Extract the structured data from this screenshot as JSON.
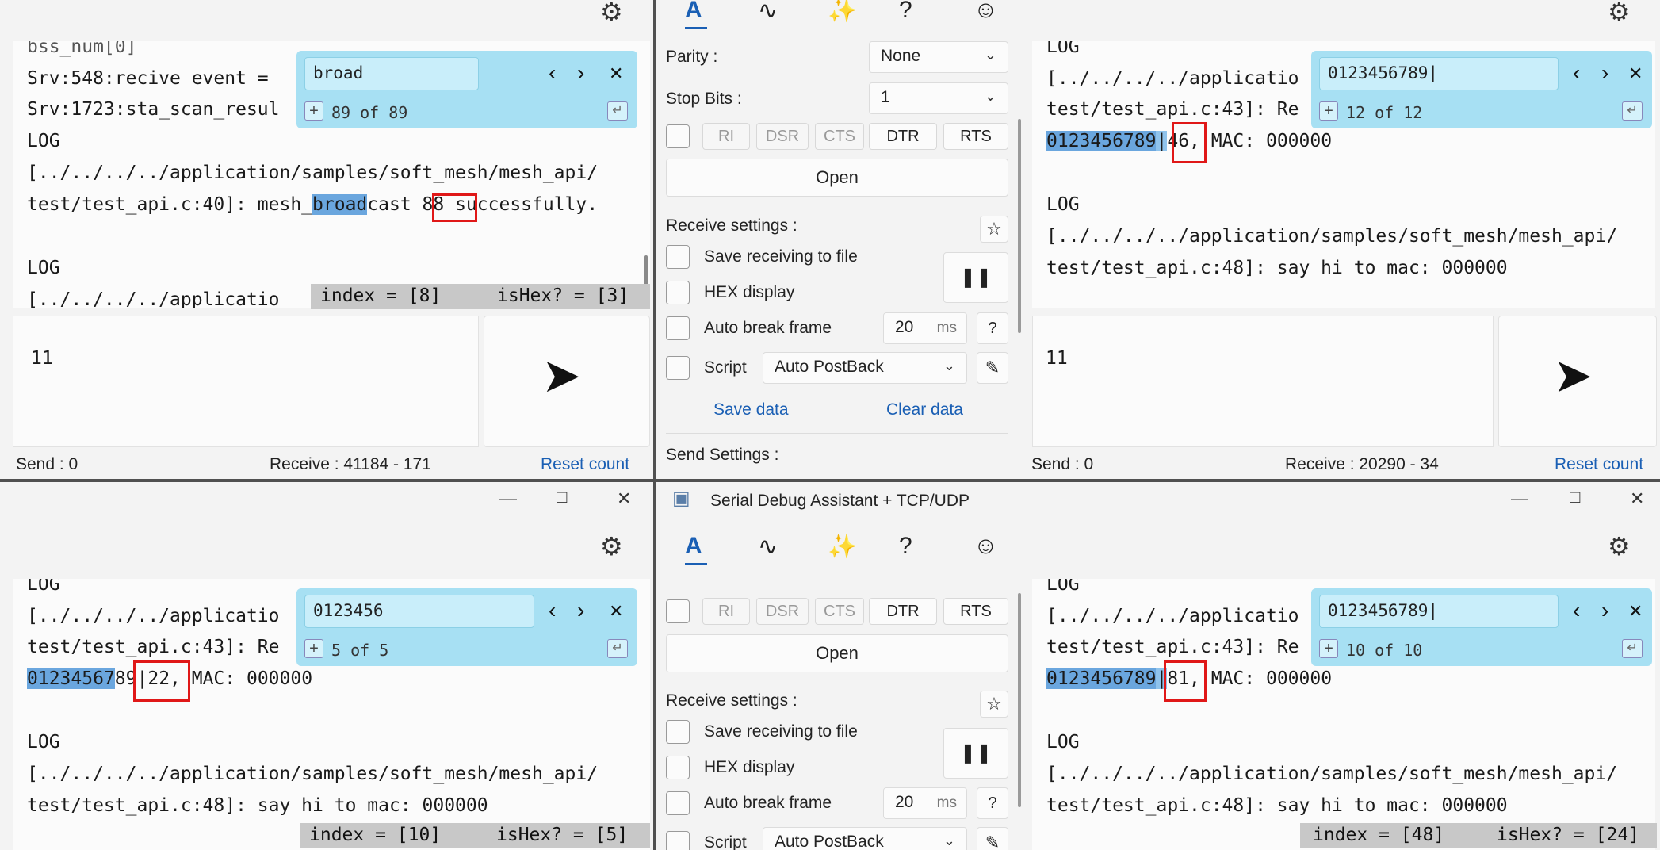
{
  "top_left": {
    "lines": [
      "bss_num[0]",
      "Srv:548:recive event = ",
      "Srv:1723:sta_scan_resul",
      "LOG",
      "[../../../../application/samples/soft_mesh/mesh_api/",
      "test/test_api.c:40]: mesh_",
      "broad",
      "cast ",
      "88",
      " successfully.",
      "LOG",
      "[../../../../applicatio"
    ],
    "find": {
      "query": "broad",
      "count": "89 of 89"
    },
    "status": {
      "index": "index = [8]",
      "ishex": "isHex? = [3]"
    },
    "send_text": "11",
    "footer": {
      "send": "Send : 0",
      "receive": "Receive : 41184 - 171",
      "reset": "Reset count"
    }
  },
  "top_mid": {
    "parity_label": "Parity :",
    "parity_value": "None",
    "stopbits_label": "Stop Bits :",
    "stopbits_value": "1",
    "pins": [
      "RI",
      "DSR",
      "CTS",
      "DTR",
      "RTS"
    ],
    "open": "Open",
    "receive_settings": "Receive settings :",
    "save_file": "Save receiving to file",
    "hex_display": "HEX display",
    "auto_break": "Auto break frame",
    "break_value": "20",
    "break_unit": "ms",
    "help": "?",
    "script": "Script",
    "script_value": "Auto PostBack",
    "save_data": "Save data",
    "clear_data": "Clear data",
    "send_settings": "Send Settings :"
  },
  "top_right": {
    "lines": [
      "LOG",
      "[../../../../applicatio",
      "test/test_api.c:43]: Re",
      "0123456789",
      "|",
      "46,",
      " MAC: 000000",
      "LOG",
      "[../../../../application/samples/soft_mesh/mesh_api/",
      "test/test_api.c:48]: say hi to mac: 000000"
    ],
    "find": {
      "query": "0123456789|",
      "count": "12 of 12"
    },
    "send_text": "11",
    "footer": {
      "send": "Send : 0",
      "receive": "Receive : 20290 - 34",
      "reset": "Reset count"
    }
  },
  "bottom_left": {
    "lines": [
      "LOG",
      "[../../../../applicatio",
      "test/test_api.c:43]: Re",
      "01234567",
      "89",
      "|",
      "22,",
      " MAC: 000000",
      "LOG",
      "[../../../../application/samples/soft_mesh/mesh_api/",
      "test/test_api.c:48]: say hi to mac: 000000"
    ],
    "find": {
      "query": "0123456",
      "count": "5 of 5"
    },
    "status": {
      "index": "index = [10]",
      "ishex": "isHex? = [5]"
    }
  },
  "bottom_mid": {
    "title": "Serial Debug Assistant + TCP/UDP",
    "pins": [
      "RI",
      "DSR",
      "CTS",
      "DTR",
      "RTS"
    ],
    "open": "Open",
    "receive_settings": "Receive settings :",
    "save_file": "Save receiving to file",
    "hex_display": "HEX display",
    "auto_break": "Auto break frame",
    "break_value": "20",
    "break_unit": "ms",
    "help": "?",
    "script": "Script",
    "script_value": "Auto PostBack"
  },
  "bottom_right": {
    "lines": [
      "LOG",
      "[../../../../applicatio",
      "test/test_api.c:43]: Re",
      "0123456789",
      "|",
      "81,",
      " MAC: 000000",
      "LOG",
      "[../../../../application/samples/soft_mesh/mesh_api/",
      "test/test_api.c:48]: say hi to mac: 000000"
    ],
    "find": {
      "query": "0123456789|",
      "count": "10 of 10"
    },
    "status": {
      "index": "index = [48]",
      "ishex": "isHex? = [24]"
    }
  },
  "icons": {
    "font": "A",
    "wave": "∿",
    "magic": "✨",
    "help": "?",
    "smile": "☺",
    "gear": "⚙",
    "prev": "‹",
    "next": "›",
    "close": "✕",
    "plus": "+",
    "enter": "↵",
    "send": "➤",
    "chev": "⌄",
    "star": "☆",
    "pencil": "✎",
    "pause": "❚❚",
    "minimize": "—",
    "maximize": "□",
    "win_close": "✕",
    "app": "▣"
  },
  "colors": {
    "find_bg": "#a7e0f3",
    "highlight": "#6aa6de",
    "red_box": "#e01818",
    "link": "#1a5fb4"
  }
}
